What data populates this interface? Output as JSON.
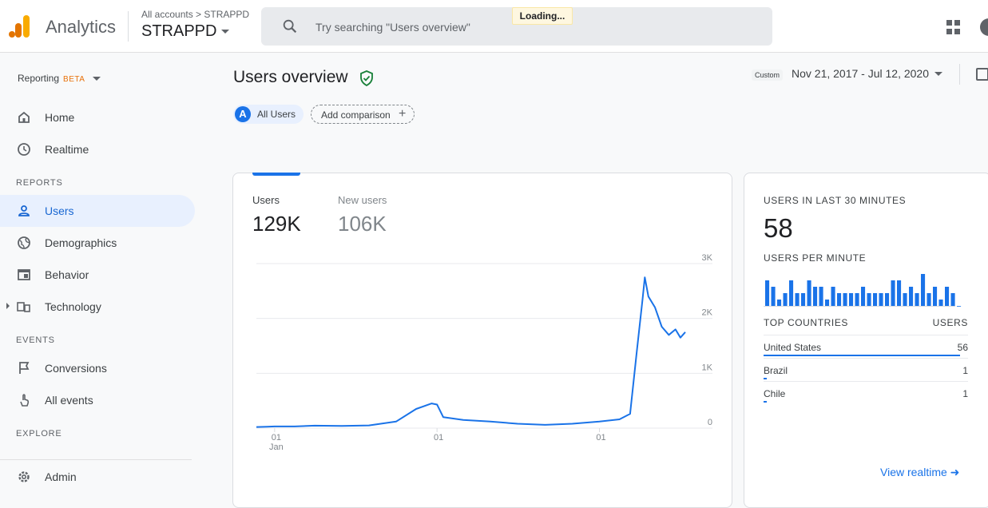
{
  "topbar": {
    "app_name": "Analytics",
    "breadcrumb": "All accounts > STRAPPD",
    "account": "STRAPPD",
    "search_placeholder": "Try searching \"Users overview\"",
    "loading": "Loading..."
  },
  "sidebar": {
    "reporting": "Reporting",
    "beta": "BETA",
    "items_top": [
      {
        "label": "Home",
        "icon": "home-icon"
      },
      {
        "label": "Realtime",
        "icon": "clock-icon"
      }
    ],
    "reports_header": "REPORTS",
    "reports": [
      {
        "label": "Users",
        "icon": "person-icon",
        "active": true
      },
      {
        "label": "Demographics",
        "icon": "globe-icon"
      },
      {
        "label": "Behavior",
        "icon": "window-icon"
      },
      {
        "label": "Technology",
        "icon": "devices-icon"
      }
    ],
    "events_header": "EVENTS",
    "events": [
      {
        "label": "Conversions",
        "icon": "flag-icon"
      },
      {
        "label": "All events",
        "icon": "touch-icon"
      }
    ],
    "explore_header": "EXPLORE",
    "admin": "Admin"
  },
  "header": {
    "title": "Users overview",
    "date_chip": "Custom",
    "date_range": "Nov 21, 2017 - Jul 12, 2020"
  },
  "comparison": {
    "avatar_letter": "A",
    "all_users": "All Users",
    "add_comparison": "Add comparison"
  },
  "main_card": {
    "metrics": [
      {
        "label": "Users",
        "value": "129K",
        "selected": true
      },
      {
        "label": "New users",
        "value": "106K",
        "selected": false
      }
    ]
  },
  "chart_data": {
    "type": "line",
    "series": [
      {
        "name": "Users",
        "color": "#1a73e8",
        "points": [
          [
            "2017-11-21",
            20
          ],
          [
            "2017-12-15",
            25
          ],
          [
            "2018-01-01",
            30
          ],
          [
            "2018-02-15",
            30
          ],
          [
            "2018-04-01",
            45
          ],
          [
            "2018-06-01",
            40
          ],
          [
            "2018-08-01",
            50
          ],
          [
            "2018-10-01",
            120
          ],
          [
            "2018-11-15",
            350
          ],
          [
            "2018-12-20",
            450
          ],
          [
            "2019-01-01",
            430
          ],
          [
            "2019-01-15",
            200
          ],
          [
            "2019-03-01",
            150
          ],
          [
            "2019-05-01",
            120
          ],
          [
            "2019-07-01",
            80
          ],
          [
            "2019-09-01",
            60
          ],
          [
            "2019-11-01",
            80
          ],
          [
            "2020-01-01",
            120
          ],
          [
            "2020-02-15",
            160
          ],
          [
            "2020-03-10",
            260
          ],
          [
            "2020-03-25",
            1400
          ],
          [
            "2020-04-07",
            2350
          ],
          [
            "2020-04-12",
            2750
          ],
          [
            "2020-04-20",
            2400
          ],
          [
            "2020-05-05",
            2200
          ],
          [
            "2020-05-20",
            1850
          ],
          [
            "2020-06-05",
            1700
          ],
          [
            "2020-06-20",
            1800
          ],
          [
            "2020-07-01",
            1650
          ],
          [
            "2020-07-12",
            1750
          ]
        ]
      }
    ],
    "x_tick_labels": [
      "01\nJan",
      "01",
      "01"
    ],
    "y_tick_labels": [
      "3K",
      "2K",
      "1K",
      "0"
    ],
    "ylim": [
      0,
      3000
    ],
    "grid": true
  },
  "realtime": {
    "users_30min_label": "USERS IN LAST 30 MINUTES",
    "users_30min_value": "58",
    "per_minute_label": "USERS PER MINUTE",
    "per_minute": [
      4,
      3,
      1,
      2,
      4,
      2,
      2,
      4,
      3,
      3,
      1,
      3,
      2,
      2,
      2,
      2,
      3,
      2,
      2,
      2,
      2,
      4,
      4,
      2,
      3,
      2,
      5,
      2,
      3,
      1,
      3,
      2,
      0
    ],
    "per_minute_max": 5,
    "countries_label": "TOP COUNTRIES",
    "users_col_label": "USERS",
    "countries": [
      {
        "name": "United States",
        "users": "56",
        "fraction": 1.0
      },
      {
        "name": "Brazil",
        "users": "1",
        "fraction": 0.018
      },
      {
        "name": "Chile",
        "users": "1",
        "fraction": 0.018
      }
    ],
    "view_realtime": "View realtime"
  },
  "colors": {
    "accent": "#1a73e8",
    "logo_orange": "#f9ab00",
    "logo_dark_orange": "#e37400",
    "shield": "#188038"
  }
}
